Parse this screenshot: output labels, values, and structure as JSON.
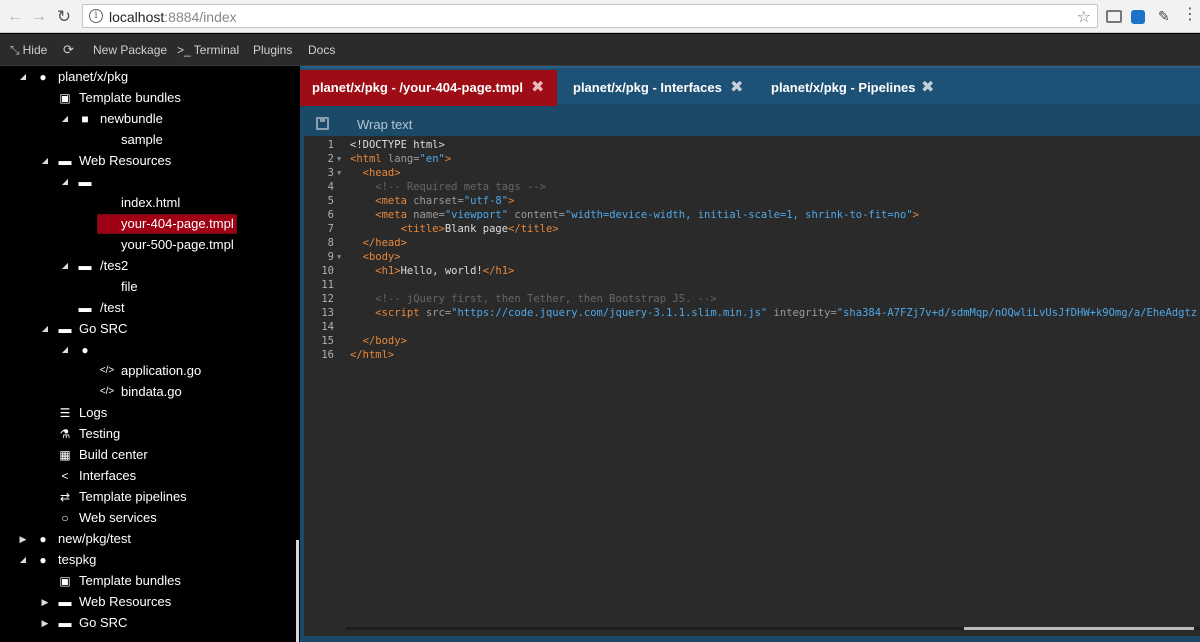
{
  "browser": {
    "url_host": "localhost",
    "url_rest": ":8884/index",
    "back_icon": "←",
    "forward_icon": "→",
    "reload_icon": "↻",
    "info_icon": "i",
    "star_icon": "☆",
    "pen_icon": "✎",
    "menu_icon": "⋮"
  },
  "toolbar": {
    "hide_icon": "⤡",
    "hide_label": "Hide",
    "refresh_icon": "⟳",
    "new_package_label": "New Package",
    "terminal_label": ">_ Terminal",
    "plugins_label": "Plugins",
    "docs_label": "Docs"
  },
  "tree": {
    "caret_down": "◢",
    "caret_right": "▶",
    "globe_icon": "🌐",
    "nodes": [
      {
        "label": "planet/x/pkg",
        "icon": "●"
      },
      {
        "label": "Template bundles",
        "icon": "▣"
      },
      {
        "label": "newbundle",
        "icon": "■"
      },
      {
        "label": "sample",
        "icon": ""
      },
      {
        "label": "Web Resources",
        "icon": "▬"
      },
      {
        "label": "",
        "icon": "▬"
      },
      {
        "label": "index.html",
        "icon": ""
      },
      {
        "label": "your-404-page.tmpl",
        "icon": ""
      },
      {
        "label": "your-500-page.tmpl",
        "icon": ""
      },
      {
        "label": "/tes2",
        "icon": "▬"
      },
      {
        "label": "file",
        "icon": ""
      },
      {
        "label": "/test",
        "icon": "▬"
      },
      {
        "label": "Go SRC",
        "icon": "▬"
      },
      {
        "label": "",
        "icon": "●"
      },
      {
        "label": "application.go",
        "icon": "</>"
      },
      {
        "label": "bindata.go",
        "icon": "</>"
      },
      {
        "label": "Logs",
        "icon": "☰"
      },
      {
        "label": "Testing",
        "icon": "⚗"
      },
      {
        "label": "Build center",
        "icon": "▦"
      },
      {
        "label": "Interfaces",
        "icon": "<"
      },
      {
        "label": "Template pipelines",
        "icon": "⇄"
      },
      {
        "label": "Web services",
        "icon": "○"
      },
      {
        "label": "new/pkg/test",
        "icon": "●"
      },
      {
        "label": "tespkg",
        "icon": "●"
      },
      {
        "label": "Template bundles",
        "icon": "▣"
      },
      {
        "label": "Web Resources",
        "icon": "▬"
      },
      {
        "label": "Go SRC",
        "icon": "▬"
      }
    ]
  },
  "tabs": [
    {
      "label": "planet/x/pkg - /your-404-page.tmpl",
      "close": "✖"
    },
    {
      "label": "planet/x/pkg - Interfaces",
      "close": "✖"
    },
    {
      "label": "planet/x/pkg - Pipelines",
      "close": "✖"
    }
  ],
  "editor": {
    "wrap_text_label": "Wrap text",
    "fold_marker": "▼",
    "line_numbers": [
      "1",
      "2",
      "3",
      "4",
      "5",
      "6",
      "7",
      "8",
      "9",
      "10",
      "11",
      "12",
      "13",
      "14",
      "15",
      "16"
    ],
    "code": {
      "l1": "<!DOCTYPE html>",
      "l2a": "<html",
      "l2b": " lang=",
      "l2c": "\"en\"",
      "l2d": ">",
      "l3": "  <head>",
      "l4": "    <!-- Required meta tags -->",
      "l5a": "    <meta",
      "l5b": " charset=",
      "l5c": "\"utf-8\"",
      "l5d": ">",
      "l6a": "    <meta",
      "l6b": " name=",
      "l6c": "\"viewport\"",
      "l6d": " content=",
      "l6e": "\"width=device-width, initial-scale=1, shrink-to-fit=no\"",
      "l6f": ">",
      "l7a": "        <title>",
      "l7b": "Blank page",
      "l7c": "</title>",
      "l8": "  </head>",
      "l9": "  <body>",
      "l10a": "    <h1>",
      "l10b": "Hello, world!",
      "l10c": "</h1>",
      "l12": "    <!-- jQuery first, then Tether, then Bootstrap JS. -->",
      "l13a": "    <script",
      "l13b": " src=",
      "l13c": "\"https://code.jquery.com/jquery-3.1.1.slim.min.js\"",
      "l13d": " integrity=",
      "l13e": "\"sha384-A7FZj7v+d/sdmMqp/nOQwliLvUsJfDHW+k9Omg/a/EheAdgtz",
      "l15": "  </body>",
      "l16": "</html>"
    }
  }
}
